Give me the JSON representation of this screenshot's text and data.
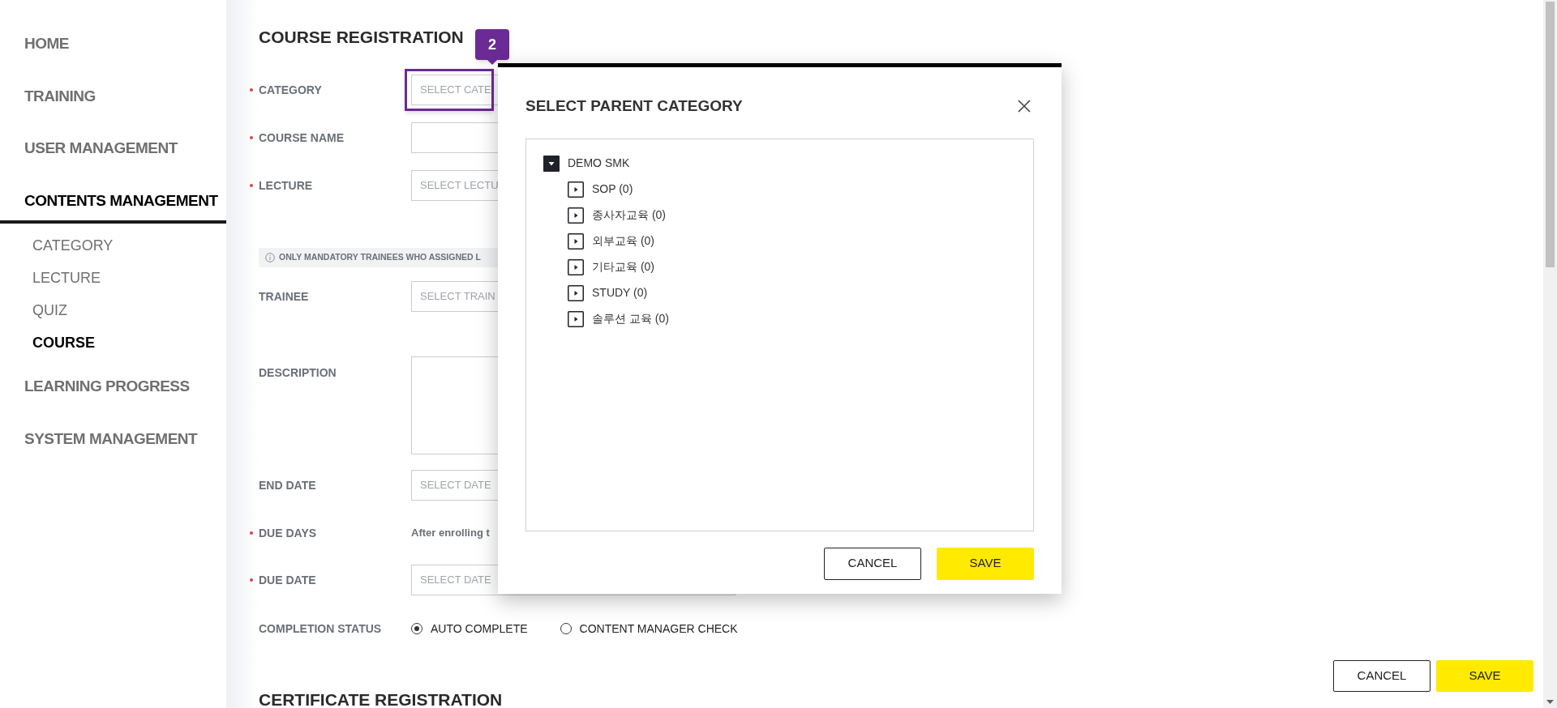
{
  "sidebar": {
    "items": [
      {
        "label": "HOME",
        "selected": false
      },
      {
        "label": "TRAINING",
        "selected": false
      },
      {
        "label": "USER MANAGEMENT",
        "selected": false
      },
      {
        "label": "CONTENTS MANAGEMENT",
        "selected": true,
        "children": [
          {
            "label": "CATEGORY",
            "selected": false
          },
          {
            "label": "LECTURE",
            "selected": false
          },
          {
            "label": "QUIZ",
            "selected": false
          },
          {
            "label": "COURSE",
            "selected": true
          }
        ]
      },
      {
        "label": "LEARNING PROGRESS",
        "selected": false
      },
      {
        "label": "SYSTEM MANAGEMENT",
        "selected": false
      }
    ]
  },
  "form": {
    "title": "COURSE REGISTRATION",
    "step_badge": "2",
    "rows": [
      {
        "kind": "select",
        "label": "CATEGORY",
        "required": true,
        "placeholder": "SELECT CATE",
        "highlighted": true
      },
      {
        "kind": "text",
        "label": "COURSE NAME",
        "required": true
      },
      {
        "kind": "select",
        "label": "LECTURE",
        "required": true,
        "placeholder": "SELECT LECTU"
      },
      {
        "kind": "notice",
        "text": "ONLY MANDATORY TRAINEES WHO ASSIGNED L"
      },
      {
        "kind": "select",
        "label": "TRAINEE",
        "required": false,
        "placeholder": "SELECT TRAIN"
      },
      {
        "kind": "textarea",
        "label": "DESCRIPTION",
        "required": false
      },
      {
        "kind": "select",
        "label": "END DATE",
        "required": false,
        "placeholder": "SELECT DATE"
      },
      {
        "kind": "info",
        "label": "DUE DAYS",
        "required": true,
        "text": "After enrolling t"
      },
      {
        "kind": "select",
        "label": "DUE DATE",
        "required": true,
        "placeholder": "SELECT DATE"
      },
      {
        "kind": "radio",
        "label": "COMPLETION STATUS",
        "required": false,
        "options": [
          {
            "label": "AUTO COMPLETE",
            "selected": true
          },
          {
            "label": "CONTENT MANAGER CHECK",
            "selected": false
          }
        ]
      }
    ],
    "buttons": [
      "CANCEL",
      "SAVE"
    ],
    "next_section": "CERTIFICATE REGISTRATION"
  },
  "modal": {
    "title": "SELECT PARENT CATEGORY",
    "tree": [
      {
        "label": "DEMO SMK",
        "expanded": true,
        "children": [
          {
            "label": "SOP (0)",
            "expanded": false
          },
          {
            "label": "종사자교육 (0)",
            "expanded": false
          },
          {
            "label": "외부교육 (0)",
            "expanded": false
          },
          {
            "label": "기타교육 (0)",
            "expanded": false
          },
          {
            "label": "STUDY (0)",
            "expanded": false
          },
          {
            "label": "솔루션 교육 (0)",
            "expanded": false
          }
        ]
      }
    ],
    "buttons": [
      "CANCEL",
      "SAVE"
    ]
  }
}
